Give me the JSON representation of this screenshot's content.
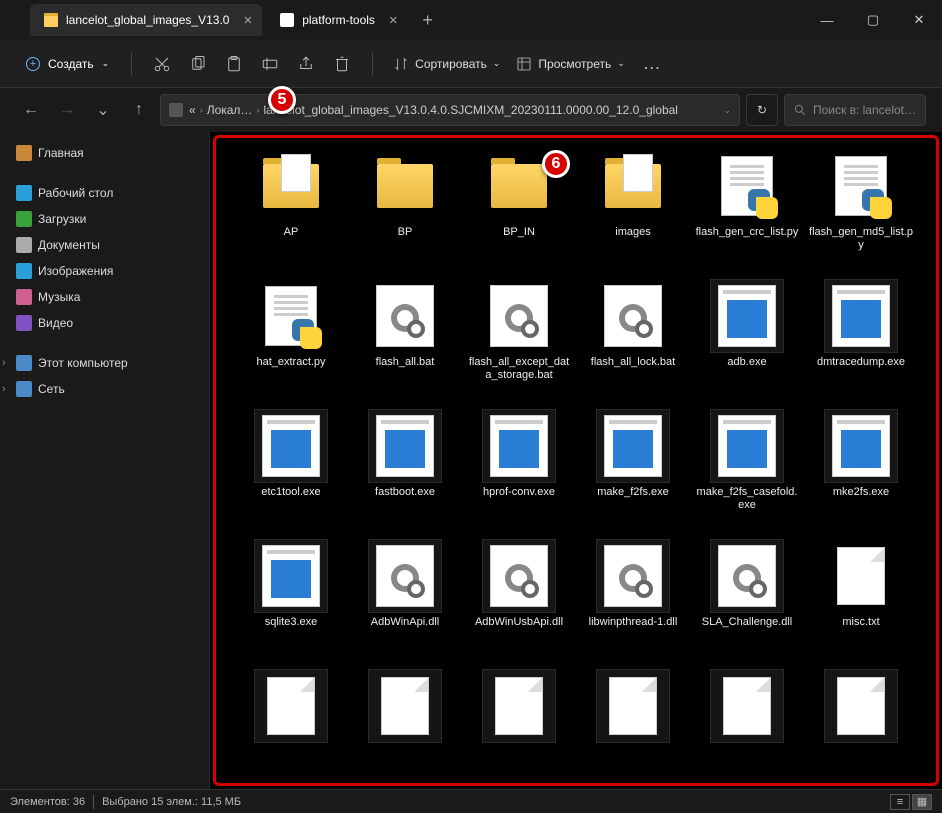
{
  "tabs": {
    "active": "lancelot_global_images_V13.0",
    "inactive": "platform-tools"
  },
  "toolbar": {
    "create": "Создать",
    "sort": "Сортировать",
    "view": "Просмотреть"
  },
  "breadcrumb": {
    "parent": "Локал…",
    "current": "lancelot_global_images_V13.0.4.0.SJCMIXM_20230111.0000.00_12.0_global"
  },
  "search": {
    "placeholder": "Поиск в: lancelot…"
  },
  "sidebar": {
    "home": "Главная",
    "desktop": "Рабочий стол",
    "downloads": "Загрузки",
    "documents": "Документы",
    "pictures": "Изображения",
    "music": "Музыка",
    "videos": "Видео",
    "thispc": "Этот компьютер",
    "network": "Сеть"
  },
  "files": [
    {
      "name": "AP",
      "type": "folder-paper",
      "sel": false
    },
    {
      "name": "BP",
      "type": "folder",
      "sel": false
    },
    {
      "name": "BP_IN",
      "type": "folder",
      "sel": false
    },
    {
      "name": "images",
      "type": "folder-paper",
      "sel": false
    },
    {
      "name": "flash_gen_crc_list.py",
      "type": "py",
      "sel": false
    },
    {
      "name": "flash_gen_md5_list.py",
      "type": "py",
      "sel": false
    },
    {
      "name": "hat_extract.py",
      "type": "py",
      "sel": false
    },
    {
      "name": "flash_all.bat",
      "type": "bat",
      "sel": false
    },
    {
      "name": "flash_all_except_data_storage.bat",
      "type": "bat",
      "sel": false
    },
    {
      "name": "flash_all_lock.bat",
      "type": "bat",
      "sel": false
    },
    {
      "name": "adb.exe",
      "type": "exe",
      "sel": true
    },
    {
      "name": "dmtracedump.exe",
      "type": "exe",
      "sel": true
    },
    {
      "name": "etc1tool.exe",
      "type": "exe",
      "sel": true
    },
    {
      "name": "fastboot.exe",
      "type": "exe",
      "sel": true
    },
    {
      "name": "hprof-conv.exe",
      "type": "exe",
      "sel": true
    },
    {
      "name": "make_f2fs.exe",
      "type": "exe",
      "sel": true
    },
    {
      "name": "make_f2fs_casefold.exe",
      "type": "exe",
      "sel": true
    },
    {
      "name": "mke2fs.exe",
      "type": "exe",
      "sel": true
    },
    {
      "name": "sqlite3.exe",
      "type": "exe",
      "sel": true
    },
    {
      "name": "AdbWinApi.dll",
      "type": "bat",
      "sel": true
    },
    {
      "name": "AdbWinUsbApi.dll",
      "type": "bat",
      "sel": true
    },
    {
      "name": "libwinpthread-1.dll",
      "type": "bat",
      "sel": true
    },
    {
      "name": "SLA_Challenge.dll",
      "type": "bat",
      "sel": true
    },
    {
      "name": "misc.txt",
      "type": "txt",
      "sel": false
    },
    {
      "name": "",
      "type": "txt",
      "sel": true
    },
    {
      "name": "",
      "type": "txt",
      "sel": true
    },
    {
      "name": "",
      "type": "txt",
      "sel": true
    },
    {
      "name": "",
      "type": "txt",
      "sel": true
    },
    {
      "name": "",
      "type": "txt",
      "sel": true
    },
    {
      "name": "",
      "type": "txt",
      "sel": true
    }
  ],
  "status": {
    "count": "Элементов: 36",
    "selection": "Выбрано 15 элем.: 11,5 МБ"
  },
  "callouts": {
    "c5": "5",
    "c6": "6"
  }
}
